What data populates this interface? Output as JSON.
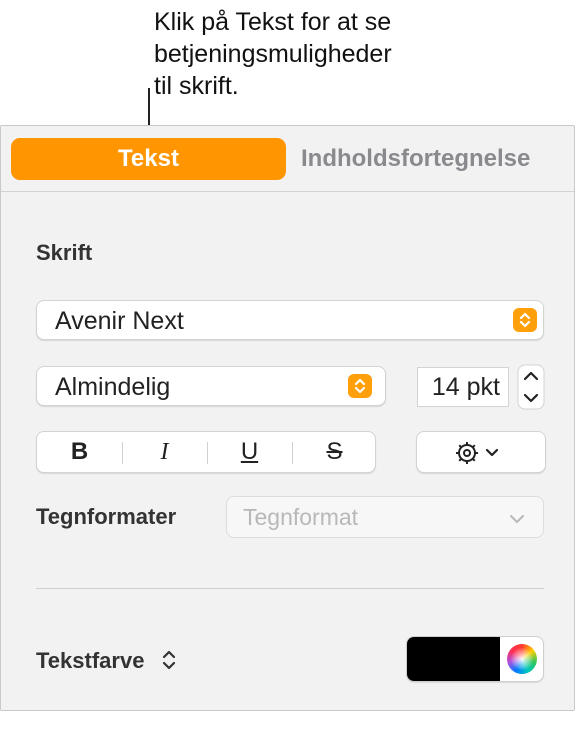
{
  "callout": {
    "lines": [
      "Klik på Tekst for at se",
      "betjeningsmuligheder",
      "til skrift."
    ]
  },
  "tabs": [
    {
      "label": "Tekst",
      "active": true
    },
    {
      "label": "Indholdsfortegnelse",
      "active": false
    }
  ],
  "font_section": {
    "title": "Skrift",
    "font_family": "Avenir Next",
    "typeface": "Almindelig",
    "size": "14 pkt",
    "style_buttons": {
      "bold": "B",
      "italic": "I",
      "underline": "U",
      "strikethrough": "S"
    }
  },
  "char_styles": {
    "label": "Tegnformater",
    "placeholder": "Tegnformat"
  },
  "text_color": {
    "label": "Tekstfarve",
    "value": "#000000"
  },
  "colors": {
    "accent": "#ff9500",
    "panel_bg": "#f2f2f2"
  }
}
